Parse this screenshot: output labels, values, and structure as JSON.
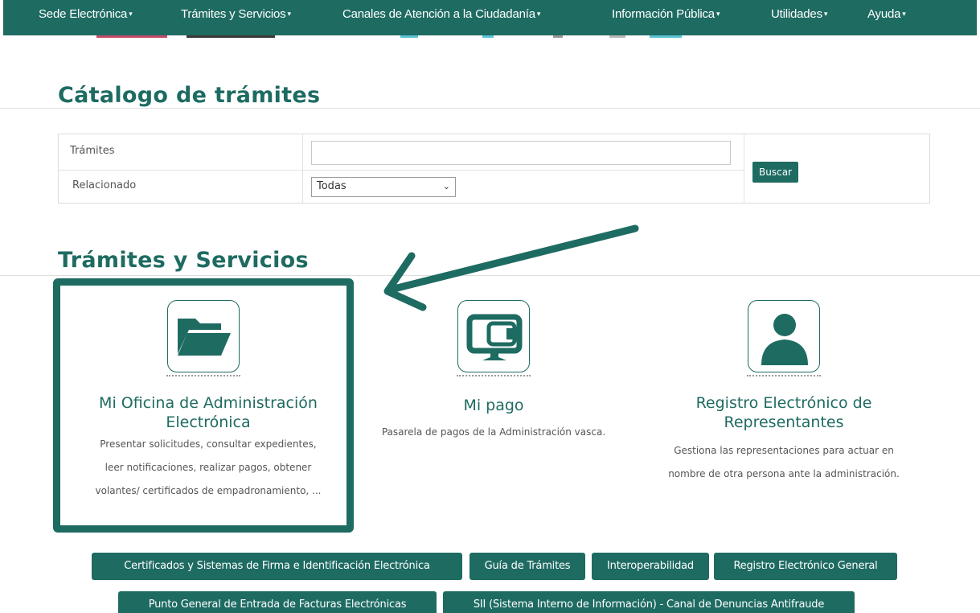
{
  "nav": {
    "items": [
      {
        "label": "Sede Electrónica"
      },
      {
        "label": "Trámites y Servicios"
      },
      {
        "label": "Canales de Atención a la Ciudadanía"
      },
      {
        "label": "Información Pública"
      },
      {
        "label": "Utilidades"
      },
      {
        "label": "Ayuda"
      }
    ],
    "caret": "▾"
  },
  "catalog": {
    "title": "Cátalogo de trámites",
    "tramites_label": "Trámites",
    "tramites_value": "",
    "relacionado_label": "Relacionado",
    "relacionado_selected": "Todas",
    "search_button": "Buscar"
  },
  "services": {
    "title": "Trámites y Servicios",
    "cards": [
      {
        "icon": "folder-icon",
        "title_line1": "Mi Oficina de Administración",
        "title_line2": "Electrónica",
        "desc_line1": "Presentar solicitudes, consultar expedientes,",
        "desc_line2": "leer notificaciones, realizar pagos, obtener",
        "desc_line3": "volantes/ certificados de empadronamiento, ..."
      },
      {
        "icon": "payment-terminal-icon",
        "title_line1": "Mi pago",
        "desc_line1": "Pasarela de pagos de la Administración vasca."
      },
      {
        "icon": "person-icon",
        "title_line1": "Registro Electrónico de",
        "title_line2": "Representantes",
        "desc_line1": "Gestiona las representaciones para actuar en",
        "desc_line2": "nombre de otra persona ante la administración."
      }
    ]
  },
  "quick_links": [
    {
      "label": "Certificados y Sistemas de Firma e Identificación Electrónica"
    },
    {
      "label": "Guía de Trámites"
    },
    {
      "label": "Interoperabilidad"
    },
    {
      "label": "Registro Electrónico General"
    },
    {
      "label": "Punto General de Entrada de Facturas Electrónicas"
    },
    {
      "label": "SII (Sistema Interno de Información) - Canal de Denuncias Antifraude"
    }
  ],
  "colors": {
    "brand": "#1e6b62",
    "text": "#555555"
  }
}
